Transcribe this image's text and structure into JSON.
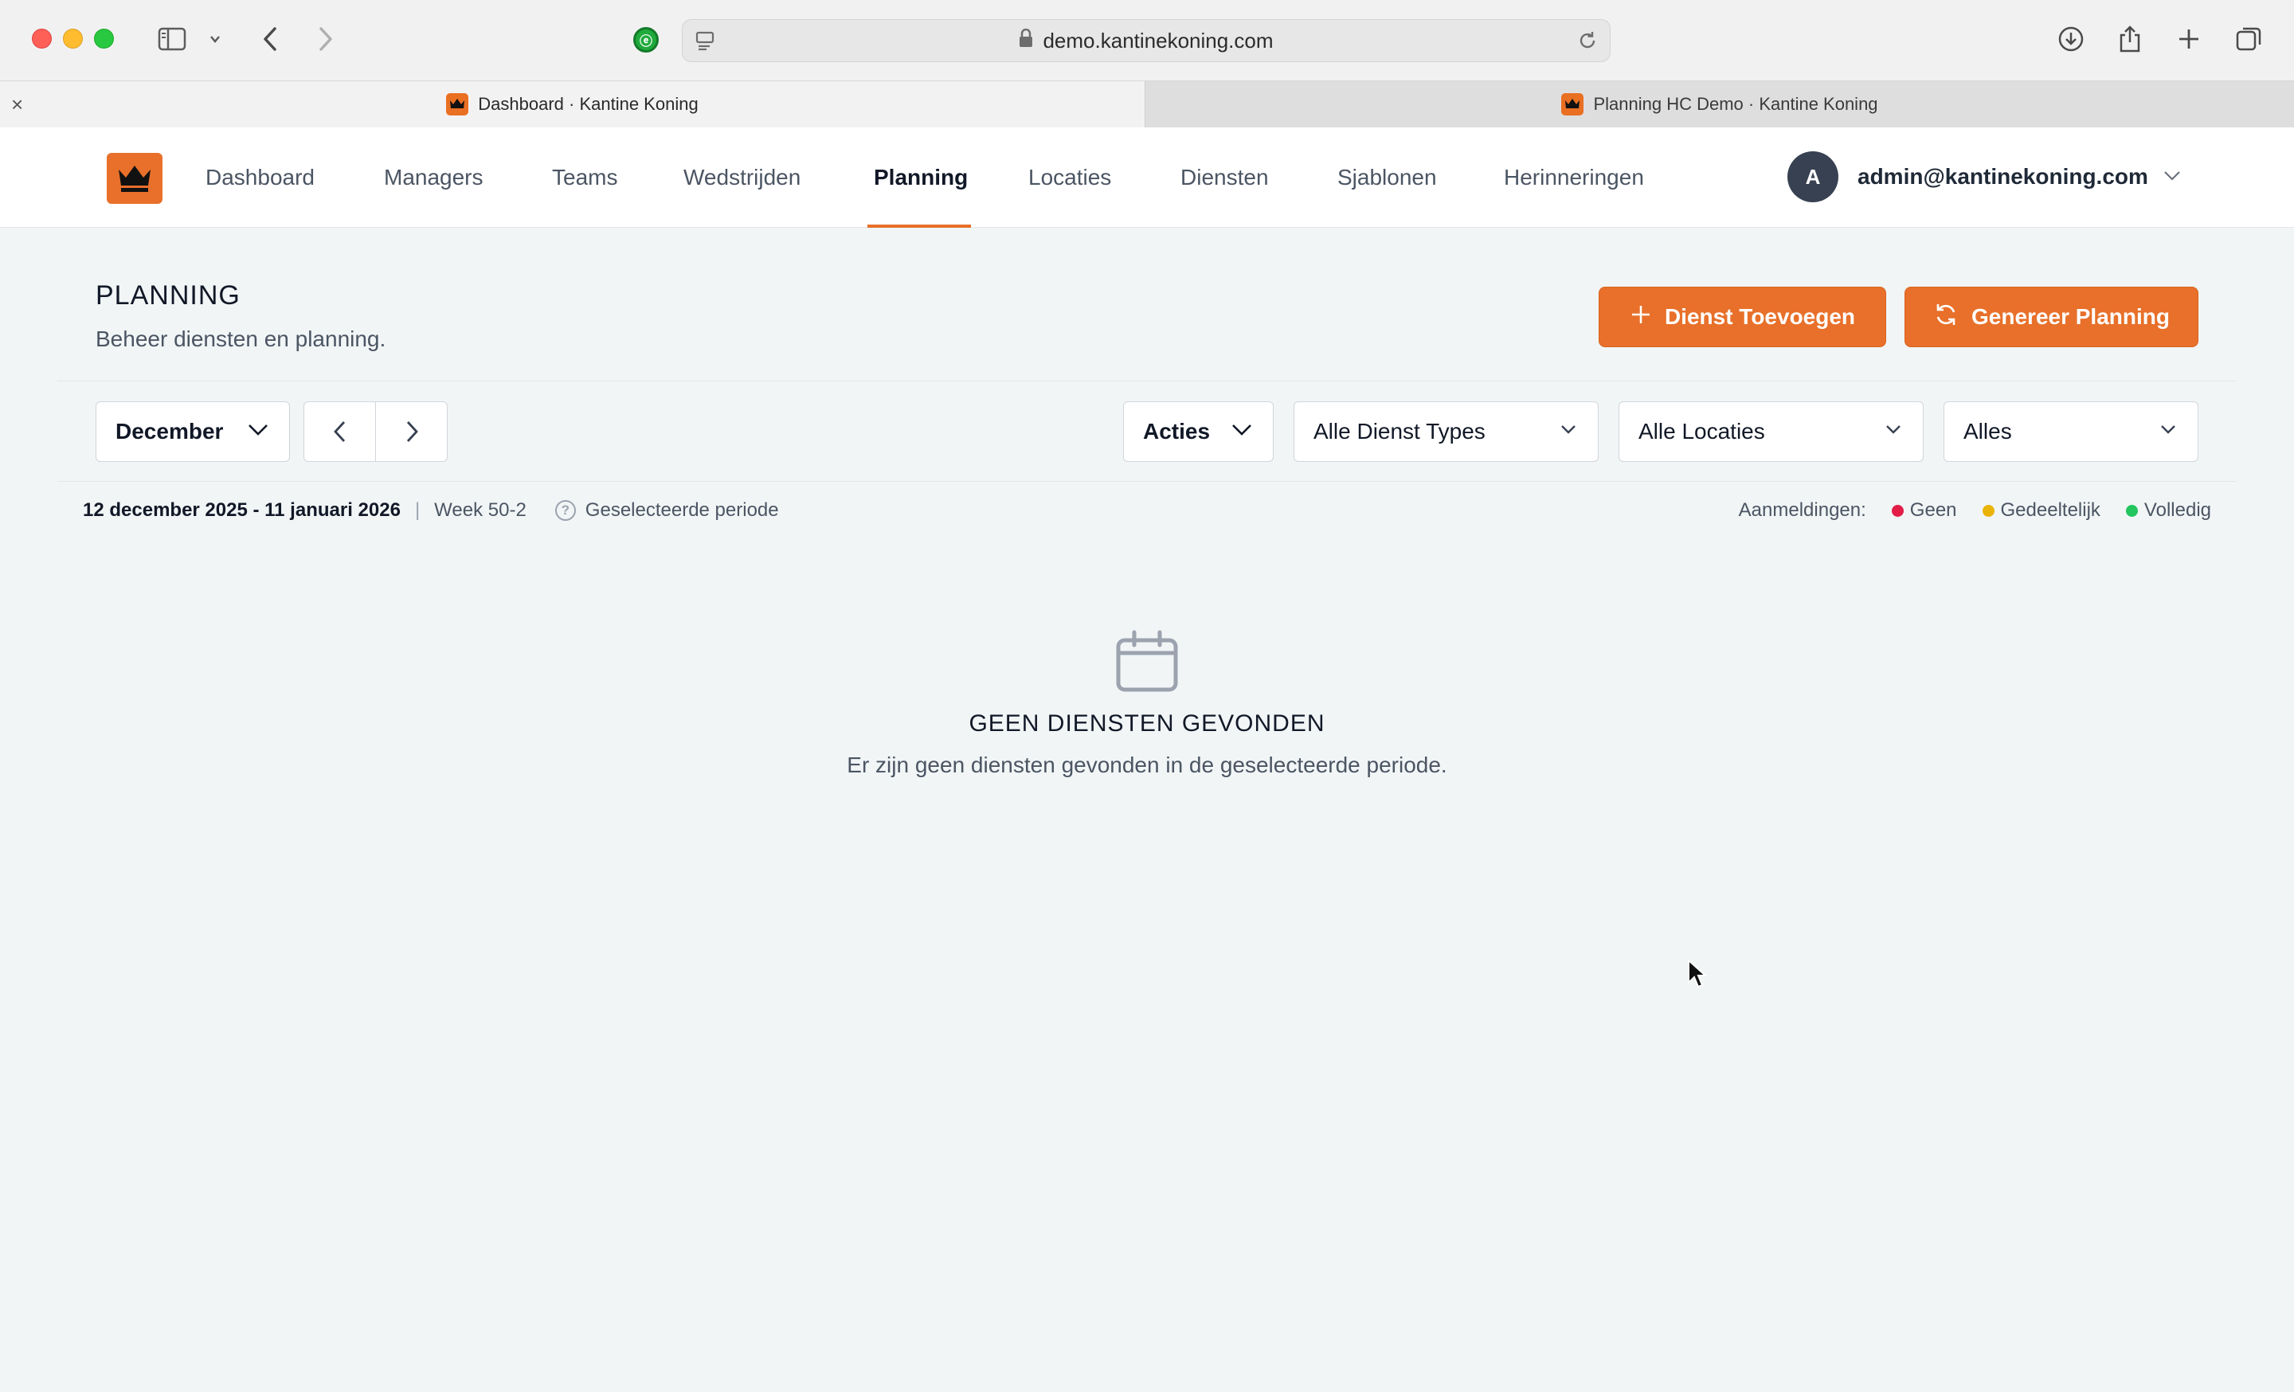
{
  "browser": {
    "url": "demo.kantinekoning.com",
    "tabs": [
      {
        "title": "Dashboard · Kantine Koning",
        "active": true
      },
      {
        "title": "Planning HC Demo · Kantine Koning",
        "active": false
      }
    ],
    "tab_close_label": "×"
  },
  "nav": {
    "items": [
      "Dashboard",
      "Managers",
      "Teams",
      "Wedstrijden",
      "Planning",
      "Locaties",
      "Diensten",
      "Sjablonen",
      "Herinneringen"
    ],
    "active": "Planning",
    "avatar_initial": "A",
    "user_email": "admin@kantinekoning.com"
  },
  "page": {
    "title": "PLANNING",
    "subtitle": "Beheer diensten en planning.",
    "add_button": "Dienst Toevoegen",
    "generate_button": "Genereer Planning"
  },
  "filters": {
    "month": "December",
    "actions": "Acties",
    "service_type": "Alle Dienst Types",
    "location": "Alle Locaties",
    "status": "Alles"
  },
  "period": {
    "range": "12 december 2025 - 11 januari 2026",
    "separator": "|",
    "week": "Week 50-2",
    "help_icon": "?",
    "selected_label": "Geselecteerde periode"
  },
  "legend": {
    "label": "Aanmeldingen:",
    "items": [
      {
        "label": "Geen",
        "color": "#e11d48"
      },
      {
        "label": "Gedeeltelijk",
        "color": "#eab308"
      },
      {
        "label": "Volledig",
        "color": "#22c55e"
      }
    ]
  },
  "empty": {
    "title": "GEEN DIENSTEN GEVONDEN",
    "text": "Er zijn geen diensten gevonden in de geselecteerde periode."
  },
  "colors": {
    "accent": "#e8702a",
    "background": "#f1f5f6"
  }
}
